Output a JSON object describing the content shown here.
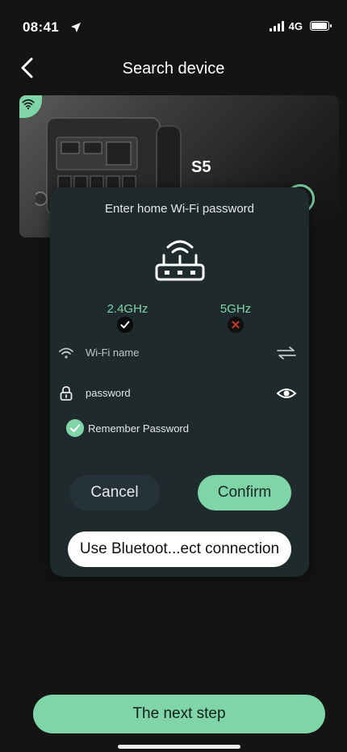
{
  "status": {
    "time": "08:41",
    "network": "4G"
  },
  "header": {
    "title": "Search device"
  },
  "device": {
    "name": "S5"
  },
  "dialog": {
    "title": "Enter home Wi-Fi password",
    "band_24": "2.4GHz",
    "band_5": "5GHz",
    "wifi_placeholder": "Wi-Fi name",
    "password_placeholder": "password",
    "remember_label": "Remember Password",
    "cancel_label": "Cancel",
    "confirm_label": "Confirm",
    "bluetooth_label": "Use Bluetoot...ect connection"
  },
  "footer": {
    "next_label": "The next step"
  },
  "colors": {
    "accent": "#7fd4a8",
    "background": "#141414",
    "dialog_bg": "#1f2a2d",
    "error": "#c0392b"
  }
}
